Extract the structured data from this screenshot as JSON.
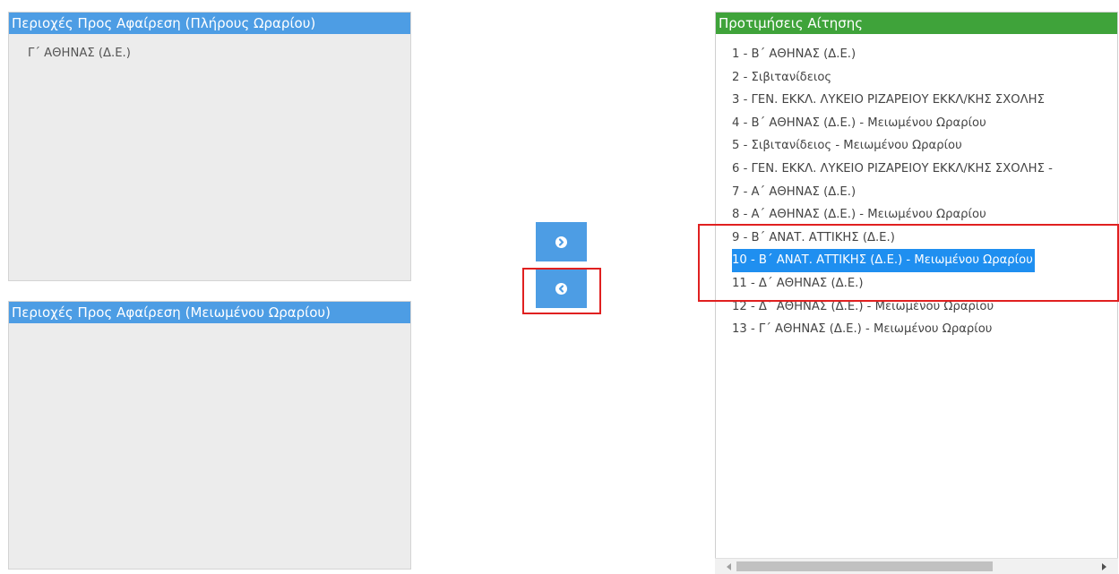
{
  "full_panel": {
    "title": "Περιοχές Προς Αφαίρεση (Πλήρους Ωραρίου)",
    "items": [
      "Γ΄ ΑΘΗΝΑΣ (Δ.Ε.)"
    ]
  },
  "reduced_panel": {
    "title": "Περιοχές Προς Αφαίρεση (Μειωμένου Ωραρίου)",
    "items": []
  },
  "prefs_panel": {
    "title": "Προτιμήσεις Αίτησης",
    "items": [
      "1 - Β΄ ΑΘΗΝΑΣ (Δ.Ε.)",
      "2 - Σιβιτανίδειος",
      "3 - ΓΕΝ. ΕΚΚΛ. ΛΥΚΕΙΟ ΡΙΖΑΡΕΙΟΥ ΕΚΚΛ/ΚΗΣ ΣΧΟΛΗΣ",
      "4 - Β΄ ΑΘΗΝΑΣ (Δ.Ε.) - Μειωμένου Ωραρίου",
      "5 - Σιβιτανίδειος - Μειωμένου Ωραρίου",
      "6 - ΓΕΝ. ΕΚΚΛ. ΛΥΚΕΙΟ ΡΙΖΑΡΕΙΟΥ ΕΚΚΛ/ΚΗΣ ΣΧΟΛΗΣ -",
      "7 - Α΄ ΑΘΗΝΑΣ (Δ.Ε.)",
      "8 - Α΄ ΑΘΗΝΑΣ (Δ.Ε.) - Μειωμένου Ωραρίου",
      "9 - Β΄ ΑΝΑΤ. ΑΤΤΙΚΗΣ (Δ.Ε.)",
      "10 - Β΄ ΑΝΑΤ. ΑΤΤΙΚΗΣ (Δ.Ε.) - Μειωμένου Ωραρίου",
      "11 - Δ΄ ΑΘΗΝΑΣ (Δ.Ε.)",
      "12 - Δ΄ ΑΘΗΝΑΣ (Δ.Ε.) - Μειωμένου Ωραρίου",
      "13 - Γ΄ ΑΘΗΝΑΣ (Δ.Ε.) - Μειωμένου Ωραρίου"
    ],
    "selected_index": 9
  },
  "buttons": {
    "move_right_icon": "chevron-circle-right-icon",
    "move_left_icon": "chevron-circle-left-icon"
  },
  "colors": {
    "header_blue": "#4d9de4",
    "header_green": "#3fa33a",
    "selection": "#1f8ff0",
    "highlight": "#e02020"
  }
}
